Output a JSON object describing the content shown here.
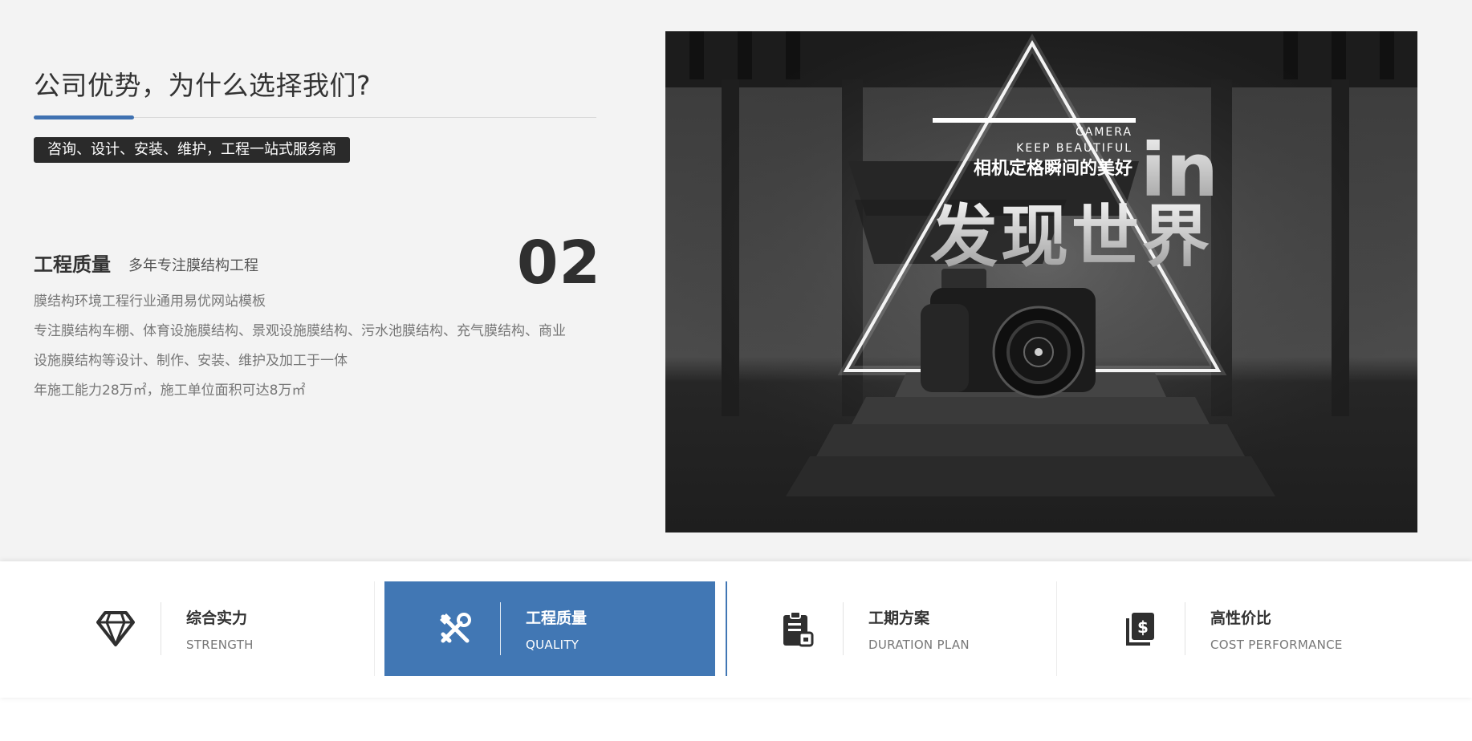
{
  "section": {
    "title": "公司优势，为什么选择我们?",
    "tagline": "咨询、设计、安装、维护，工程一站式服务商"
  },
  "feature": {
    "title": "工程质量",
    "subtitle": "多年专注膜结构工程",
    "number": "02",
    "lines": [
      "膜结构环境工程行业通用易优网站模板",
      "专注膜结构车棚、体育设施膜结构、景观设施膜结构、污水池膜结构、充气膜结构、商业",
      "设施膜结构等设计、制作、安装、维护及加工于一体",
      "年施工能力28万㎡，施工单位面积可达8万㎡"
    ]
  },
  "banner": {
    "line1": "CAMERA",
    "line2": "KEEP BEAUTIFUL",
    "line3": "相机定格瞬间的美好",
    "big": "in",
    "headline": "发现世界"
  },
  "tabs": [
    {
      "cn": "综合实力",
      "en": "STRENGTH",
      "icon": "diamond-icon"
    },
    {
      "cn": "工程质量",
      "en": "QUALITY",
      "icon": "tools-icon",
      "active": true
    },
    {
      "cn": "工期方案",
      "en": "DURATION PLAN",
      "icon": "clipboard-icon"
    },
    {
      "cn": "高性价比",
      "en": "COST PERFORMANCE",
      "icon": "dollar-book-icon"
    }
  ],
  "colors": {
    "accent": "#4177b4",
    "tag_bg": "#2a2a2a",
    "page_bg": "#f3f3f3"
  }
}
